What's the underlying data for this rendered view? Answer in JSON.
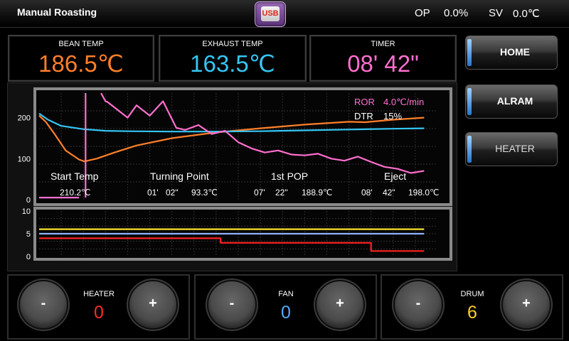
{
  "header": {
    "title": "Manual Roasting",
    "usb_label": "USB",
    "op_label": "OP",
    "op_value": "0.0%",
    "sv_label": "SV",
    "sv_value": "0.0℃"
  },
  "readouts": {
    "bean": {
      "label": "BEAN TEMP",
      "value": "186.5℃",
      "color": "#ff7f2a"
    },
    "exhaust": {
      "label": "EXHAUST TEMP",
      "value": "163.5℃",
      "color": "#35c6f4"
    },
    "timer": {
      "label": "TIMER",
      "value": "08' 42\"",
      "color": "#ff6fcf"
    }
  },
  "nav": {
    "home": "HOME",
    "alarm": "ALRAM",
    "heater": "HEATER"
  },
  "roast_info": {
    "ror_label": "ROR",
    "ror_value": "4.0℃/min",
    "dtr_label": "DTR",
    "dtr_value": "15%",
    "start_temp_label": "Start Temp",
    "start_temp_value": "210.2℃",
    "turning_point_label": "Turning Point",
    "turning_point_min": "01'",
    "turning_point_sec": "02\"",
    "turning_point_temp": "93.3℃",
    "first_pop_label": "1st POP",
    "first_pop_min": "07'",
    "first_pop_sec": "22\"",
    "first_pop_temp": "188.9℃",
    "eject_label": "Eject",
    "eject_min": "08'",
    "eject_sec": "42\"",
    "eject_temp": "198.0℃"
  },
  "chart_data": [
    {
      "type": "line",
      "y_ticks": [
        "0",
        "100",
        "200"
      ],
      "ylim": [
        0,
        260
      ],
      "xlim": [
        0,
        9
      ],
      "grid": true,
      "series": [
        {
          "color": "#ff7f2a",
          "x": [
            0,
            0.15,
            0.35,
            0.6,
            0.9,
            1.02,
            1.3,
            1.7,
            2.2,
            3.0,
            4.0,
            5.0,
            6.0,
            7.0,
            7.37,
            8.0,
            8.7
          ],
          "y": [
            205,
            190,
            160,
            120,
            98,
            93.3,
            100,
            115,
            132,
            150,
            164,
            174,
            183,
            190,
            189,
            195,
            200
          ]
        },
        {
          "color": "#35c6f4",
          "x": [
            0,
            0.2,
            0.5,
            1.0,
            1.5,
            2.0,
            3.0,
            4.0,
            5.0,
            6.0,
            7.0,
            8.0,
            8.7
          ],
          "y": [
            210,
            195,
            180,
            172,
            168,
            167,
            166,
            166,
            167,
            169,
            171,
            173,
            174
          ]
        },
        {
          "color": "#ff6fcf",
          "x": [
            1.4,
            1.45,
            1.5,
            1.55,
            2.0,
            2.2,
            2.5,
            2.8,
            3.1,
            3.3,
            3.6,
            3.9,
            4.2,
            4.5,
            4.8,
            5.1,
            5.4,
            5.7,
            6.0,
            6.3,
            6.6,
            6.9,
            7.2,
            7.5,
            7.8,
            8.1,
            8.4,
            8.7
          ],
          "y": [
            260,
            250,
            240,
            238,
            200,
            230,
            205,
            240,
            175,
            170,
            182,
            160,
            168,
            140,
            125,
            115,
            120,
            110,
            108,
            112,
            100,
            95,
            105,
            92,
            80,
            75,
            65,
            70
          ]
        },
        {
          "color": "#ff6fcf",
          "x": [
            0,
            0.9
          ],
          "y": [
            5,
            5
          ]
        },
        {
          "color": "#ff6fcf",
          "x": [
            1.05,
            1.05
          ],
          "y": [
            5,
            260
          ]
        }
      ]
    },
    {
      "type": "line",
      "y_ticks": [
        "0",
        "5",
        "10"
      ],
      "ylim": [
        0,
        10
      ],
      "xlim": [
        0,
        9
      ],
      "grid": true,
      "series": [
        {
          "color": "#f5e12b",
          "x": [
            0,
            8.7
          ],
          "y": [
            6,
            6
          ]
        },
        {
          "color": "#8fb0ff",
          "x": [
            0,
            8.7
          ],
          "y": [
            5,
            5
          ]
        },
        {
          "color": "#ff2020",
          "x": [
            0,
            4.1,
            4.1,
            7.5,
            7.5,
            8.7
          ],
          "y": [
            4,
            4,
            3,
            3,
            1.2,
            1.2
          ]
        }
      ]
    }
  ],
  "controls": {
    "heater": {
      "label": "HEATER",
      "value": "0",
      "color": "#ff2a2a"
    },
    "fan": {
      "label": "FAN",
      "value": "0",
      "color": "#5aa8ff"
    },
    "drum": {
      "label": "DRUM",
      "value": "6",
      "color": "#ffcf2a"
    },
    "minus": "-",
    "plus": "+"
  }
}
